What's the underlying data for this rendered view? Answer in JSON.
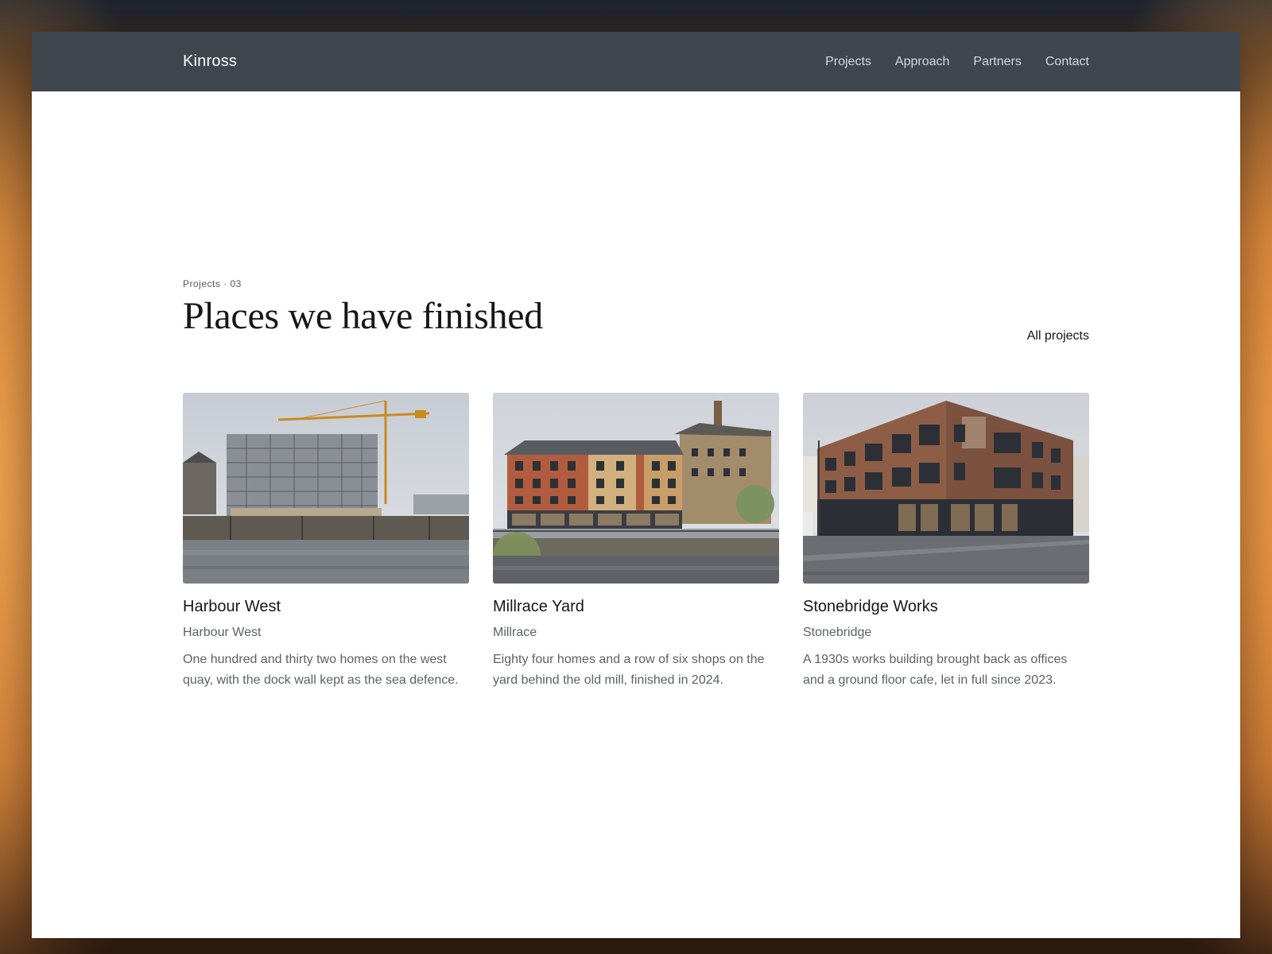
{
  "header": {
    "brand": "Kinross",
    "nav": [
      {
        "label": "Projects"
      },
      {
        "label": "Approach"
      },
      {
        "label": "Partners"
      },
      {
        "label": "Contact"
      }
    ]
  },
  "section": {
    "eyebrow": "Projects · 03",
    "title": "Places we have finished",
    "all_link": "All projects"
  },
  "projects": [
    {
      "title": "Harbour West",
      "location": "Harbour West",
      "description": "One hundred and thirty two homes on the west quay, with the dock wall kept as the sea defence."
    },
    {
      "title": "Millrace Yard",
      "location": "Millrace",
      "description": "Eighty four homes and a row of six shops on the yard behind the old mill, finished in 2024."
    },
    {
      "title": "Stonebridge Works",
      "location": "Stonebridge",
      "description": "A 1930s works building brought back as offices and a ground floor cafe, let in full since 2023."
    }
  ],
  "colors": {
    "topbar": "#3f464e",
    "heading": "#15171a",
    "muted": "#5c6168"
  }
}
